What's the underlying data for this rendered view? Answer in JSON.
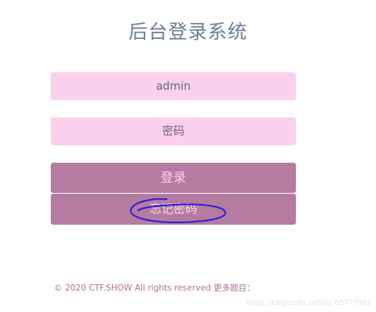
{
  "page": {
    "title": "后台登录系统"
  },
  "login_form": {
    "username_value": "admin",
    "password_placeholder": "密码",
    "login_label": "登录",
    "forgot_label": "忘记密码"
  },
  "footer": {
    "text": "© 2020 CTF.SHOW All rights reserved 更多题目："
  },
  "watermark": {
    "text": "https://blog.csdn.net/qq_65777983"
  },
  "colors": {
    "title": "#6c7b98",
    "field_bg": "#fbd0ec",
    "button_bg": "#b67ba0",
    "button_text": "#fbd3ee",
    "footer_text": "#a9729c",
    "annotation_ink": "#2a1fd6"
  }
}
